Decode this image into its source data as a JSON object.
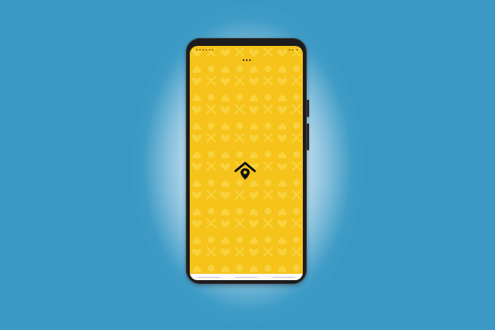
{
  "status_bar": {
    "time": "",
    "battery": "",
    "icons": [
      "notification-icon",
      "wifi-icon",
      "signal-icon",
      "battery-icon"
    ]
  },
  "splash": {
    "background_color": "#f5c31a",
    "pattern_color": "#f9d23e",
    "logo_icon": "house-location-pin-icon",
    "menu_icon": "more-dots-icon"
  },
  "background": {
    "center_color": "#ffffff",
    "edge_color": "#3a98c2"
  }
}
